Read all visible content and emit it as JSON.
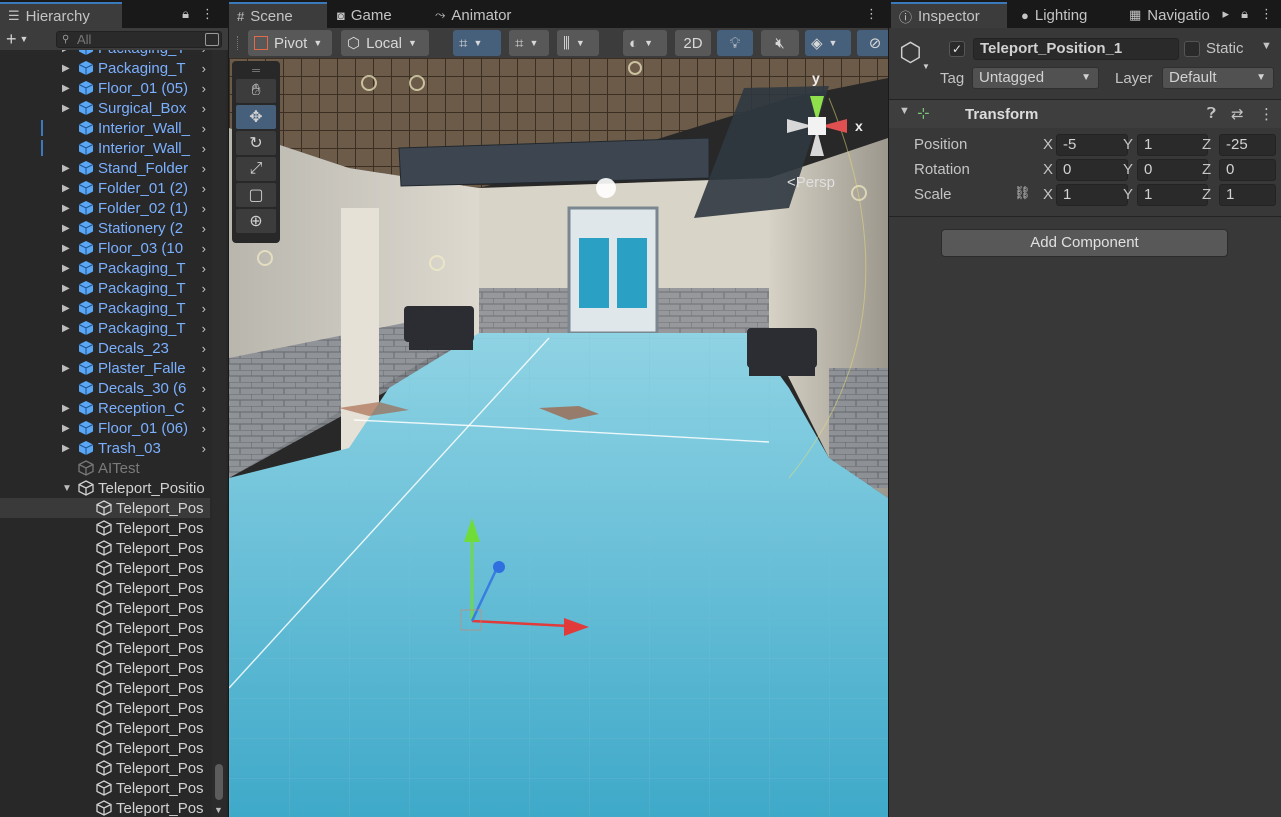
{
  "hierarchy": {
    "tab_label": "Hierarchy",
    "add_label": "+",
    "search_placeholder": "All",
    "items": [
      {
        "label": "Packaging_T",
        "type": "prefab",
        "arrow": true
      },
      {
        "label": "Packaging_T",
        "type": "prefab",
        "arrow": true
      },
      {
        "label": "Floor_01 (05)",
        "type": "prefab",
        "arrow": true
      },
      {
        "label": "Surgical_Box",
        "type": "prefab",
        "arrow": true
      },
      {
        "label": "Interior_Wall_",
        "type": "prefab",
        "arrow": false,
        "bar": true
      },
      {
        "label": "Interior_Wall_",
        "type": "prefab",
        "arrow": false,
        "bar": true
      },
      {
        "label": "Stand_Folder",
        "type": "prefab",
        "arrow": true
      },
      {
        "label": "Folder_01 (2)",
        "type": "prefab",
        "arrow": true
      },
      {
        "label": "Folder_02 (1)",
        "type": "prefab",
        "arrow": true
      },
      {
        "label": "Stationery (2",
        "type": "prefab",
        "arrow": true
      },
      {
        "label": "Floor_03 (10",
        "type": "prefab",
        "arrow": true
      },
      {
        "label": "Packaging_T",
        "type": "prefab",
        "arrow": true
      },
      {
        "label": "Packaging_T",
        "type": "prefab",
        "arrow": true
      },
      {
        "label": "Packaging_T",
        "type": "prefab",
        "arrow": true
      },
      {
        "label": "Packaging_T",
        "type": "prefab",
        "arrow": true
      },
      {
        "label": "Decals_23",
        "type": "prefab",
        "arrow": false
      },
      {
        "label": "Plaster_Falle",
        "type": "prefab",
        "arrow": true
      },
      {
        "label": "Decals_30 (6",
        "type": "prefab",
        "arrow": false
      },
      {
        "label": "Reception_C",
        "type": "prefab",
        "arrow": true
      },
      {
        "label": "Floor_01 (06)",
        "type": "prefab",
        "arrow": true
      },
      {
        "label": "Trash_03",
        "type": "prefab",
        "arrow": true
      },
      {
        "label": "AITest",
        "type": "disabled",
        "arrow": false
      },
      {
        "label": "Teleport_Positio",
        "type": "plain",
        "arrow": true,
        "expanded": true
      },
      {
        "label": "Teleport_Pos",
        "type": "plain",
        "child": true,
        "selected": true
      },
      {
        "label": "Teleport_Pos",
        "type": "plain",
        "child": true
      },
      {
        "label": "Teleport_Pos",
        "type": "plain",
        "child": true
      },
      {
        "label": "Teleport_Pos",
        "type": "plain",
        "child": true
      },
      {
        "label": "Teleport_Pos",
        "type": "plain",
        "child": true
      },
      {
        "label": "Teleport_Pos",
        "type": "plain",
        "child": true
      },
      {
        "label": "Teleport_Pos",
        "type": "plain",
        "child": true
      },
      {
        "label": "Teleport_Pos",
        "type": "plain",
        "child": true
      },
      {
        "label": "Teleport_Pos",
        "type": "plain",
        "child": true
      },
      {
        "label": "Teleport_Pos",
        "type": "plain",
        "child": true
      },
      {
        "label": "Teleport_Pos",
        "type": "plain",
        "child": true
      },
      {
        "label": "Teleport_Pos",
        "type": "plain",
        "child": true
      },
      {
        "label": "Teleport_Pos",
        "type": "plain",
        "child": true
      },
      {
        "label": "Teleport_Pos",
        "type": "plain",
        "child": true
      },
      {
        "label": "Teleport_Pos",
        "type": "plain",
        "child": true
      },
      {
        "label": "Teleport_Pos",
        "type": "plain",
        "child": true
      }
    ]
  },
  "scene": {
    "tabs": [
      {
        "label": "Scene",
        "icon": "grid-icon"
      },
      {
        "label": "Game",
        "icon": "gamepad-icon"
      },
      {
        "label": "Animator",
        "icon": "animator-icon"
      }
    ],
    "toolbar": {
      "pivot_label": "Pivot",
      "local_label": "Local",
      "mode_2d_label": "2D"
    },
    "persp_label": "Persp",
    "axis_labels": {
      "x": "x",
      "y": "y"
    }
  },
  "inspector": {
    "tabs": [
      {
        "label": "Inspector",
        "icon": "info-icon"
      },
      {
        "label": "Lighting",
        "icon": "bulb-icon"
      },
      {
        "label": "Navigatio",
        "icon": "nav-icon"
      }
    ],
    "object_name": "Teleport_Position_1",
    "active": true,
    "static_label": "Static",
    "tag_label": "Tag",
    "tag_value": "Untagged",
    "layer_label": "Layer",
    "layer_value": "Default",
    "transform": {
      "title": "Transform",
      "position_label": "Position",
      "rotation_label": "Rotation",
      "scale_label": "Scale",
      "position": {
        "x": "-5",
        "y": "1",
        "z": "-25"
      },
      "rotation": {
        "x": "0",
        "y": "0",
        "z": "0"
      },
      "scale": {
        "x": "1",
        "y": "1",
        "z": "1"
      },
      "axis_x": "X",
      "axis_y": "Y",
      "axis_z": "Z"
    },
    "add_component_label": "Add Component"
  },
  "colors": {
    "accent_blue": "#3a79bb",
    "prefab_text": "#7bb0ff",
    "selection": "#2c5d87",
    "floor_cyan": "#6cc5dc"
  }
}
